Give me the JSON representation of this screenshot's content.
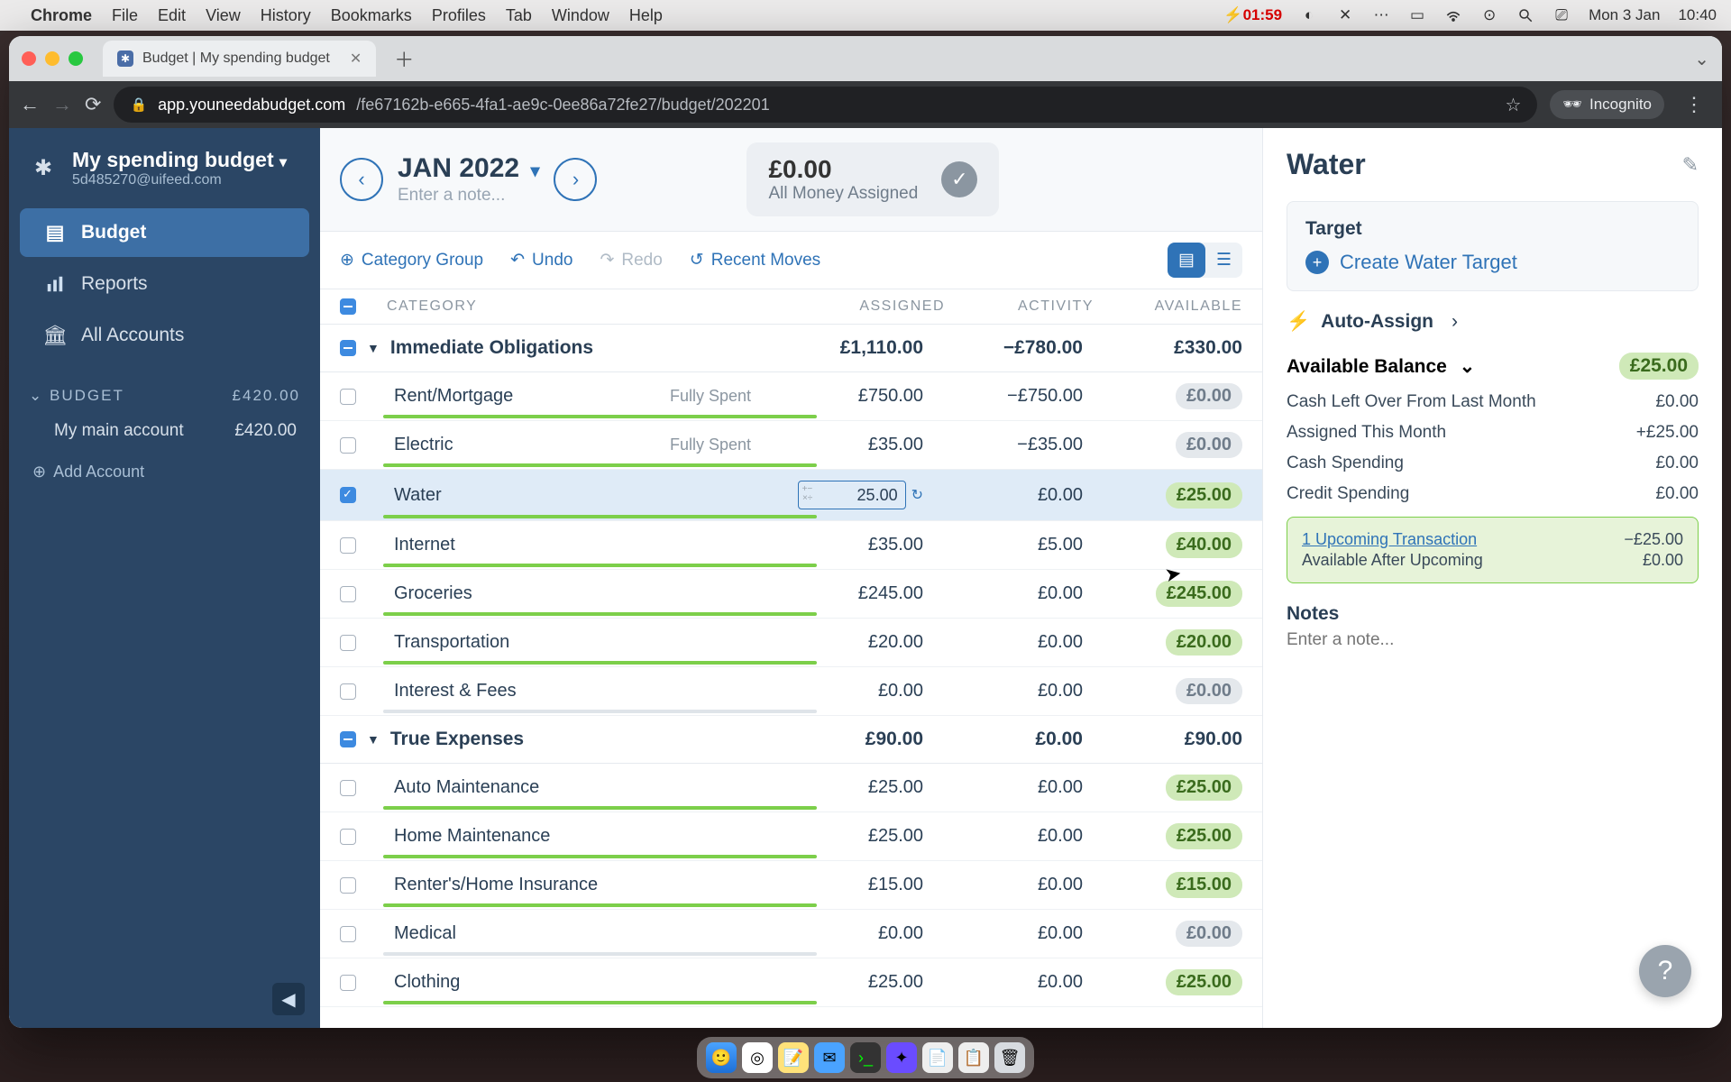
{
  "menubar": {
    "app": "Chrome",
    "items": [
      "File",
      "Edit",
      "View",
      "History",
      "Bookmarks",
      "Profiles",
      "Tab",
      "Window",
      "Help"
    ],
    "battery": "01:59",
    "date": "Mon 3 Jan",
    "time": "10:40"
  },
  "browser": {
    "tab_title": "Budget | My spending budget",
    "url_host": "app.youneedabudget.com",
    "url_path": "/fe67162b-e665-4fa1-ae9c-0ee86a72fe27/budget/202201",
    "incognito": "Incognito"
  },
  "sidebar": {
    "title": "My spending budget",
    "email": "5d485270@uifeed.com",
    "nav": [
      {
        "icon": "wallet",
        "label": "Budget"
      },
      {
        "icon": "chart",
        "label": "Reports"
      },
      {
        "icon": "bank",
        "label": "All Accounts"
      }
    ],
    "section": "BUDGET",
    "section_total": "£420.00",
    "account": {
      "name": "My main account",
      "balance": "£420.00"
    },
    "add": "Add Account"
  },
  "month": {
    "title": "JAN 2022",
    "note": "Enter a note...",
    "assign_amount": "£0.00",
    "assign_label": "All Money Assigned"
  },
  "toolbar": {
    "group": "Category Group",
    "undo": "Undo",
    "redo": "Redo",
    "recent": "Recent Moves"
  },
  "columns": {
    "cat": "CATEGORY",
    "assigned": "ASSIGNED",
    "activity": "ACTIVITY",
    "available": "AVAILABLE"
  },
  "groups": [
    {
      "name": "Immediate Obligations",
      "assigned": "£1,110.00",
      "activity": "−£780.00",
      "available": "£330.00",
      "rows": [
        {
          "name": "Rent/Mortgage",
          "status": "Fully Spent",
          "assigned": "£750.00",
          "activity": "−£750.00",
          "available": "£0.00",
          "pill": "gray",
          "bar": "green"
        },
        {
          "name": "Electric",
          "status": "Fully Spent",
          "assigned": "£35.00",
          "activity": "−£35.00",
          "available": "£0.00",
          "pill": "gray",
          "bar": "green"
        },
        {
          "name": "Water",
          "selected": true,
          "input": "25.00",
          "activity": "£0.00",
          "available": "£25.00",
          "pill": "green",
          "bar": "green"
        },
        {
          "name": "Internet",
          "assigned": "£35.00",
          "activity": "£5.00",
          "available": "£40.00",
          "pill": "green",
          "bar": "green"
        },
        {
          "name": "Groceries",
          "assigned": "£245.00",
          "activity": "£0.00",
          "available": "£245.00",
          "pill": "green",
          "bar": "green"
        },
        {
          "name": "Transportation",
          "assigned": "£20.00",
          "activity": "£0.00",
          "available": "£20.00",
          "pill": "green",
          "bar": "green"
        },
        {
          "name": "Interest & Fees",
          "assigned": "£0.00",
          "activity": "£0.00",
          "available": "£0.00",
          "pill": "gray",
          "bar": "none"
        }
      ]
    },
    {
      "name": "True Expenses",
      "assigned": "£90.00",
      "activity": "£0.00",
      "available": "£90.00",
      "rows": [
        {
          "name": "Auto Maintenance",
          "assigned": "£25.00",
          "activity": "£0.00",
          "available": "£25.00",
          "pill": "green",
          "bar": "green"
        },
        {
          "name": "Home Maintenance",
          "assigned": "£25.00",
          "activity": "£0.00",
          "available": "£25.00",
          "pill": "green",
          "bar": "green"
        },
        {
          "name": "Renter's/Home Insurance",
          "assigned": "£15.00",
          "activity": "£0.00",
          "available": "£15.00",
          "pill": "green",
          "bar": "green"
        },
        {
          "name": "Medical",
          "assigned": "£0.00",
          "activity": "£0.00",
          "available": "£0.00",
          "pill": "gray",
          "bar": "none"
        },
        {
          "name": "Clothing",
          "assigned": "£25.00",
          "activity": "£0.00",
          "available": "£25.00",
          "pill": "green",
          "bar": "green"
        }
      ]
    }
  ],
  "inspector": {
    "title": "Water",
    "target_label": "Target",
    "create": "Create Water Target",
    "auto": "Auto-Assign",
    "balance_label": "Available Balance",
    "balance": "£25.00",
    "lines": [
      {
        "l": "Cash Left Over From Last Month",
        "v": "£0.00"
      },
      {
        "l": "Assigned This Month",
        "v": "+£25.00"
      },
      {
        "l": "Cash Spending",
        "v": "£0.00"
      },
      {
        "l": "Credit Spending",
        "v": "£0.00"
      }
    ],
    "upcoming": {
      "link": "1 Upcoming Transaction",
      "amount": "−£25.00",
      "after_l": "Available After Upcoming",
      "after_v": "£0.00"
    },
    "notes_label": "Notes",
    "notes_placeholder": "Enter a note..."
  }
}
